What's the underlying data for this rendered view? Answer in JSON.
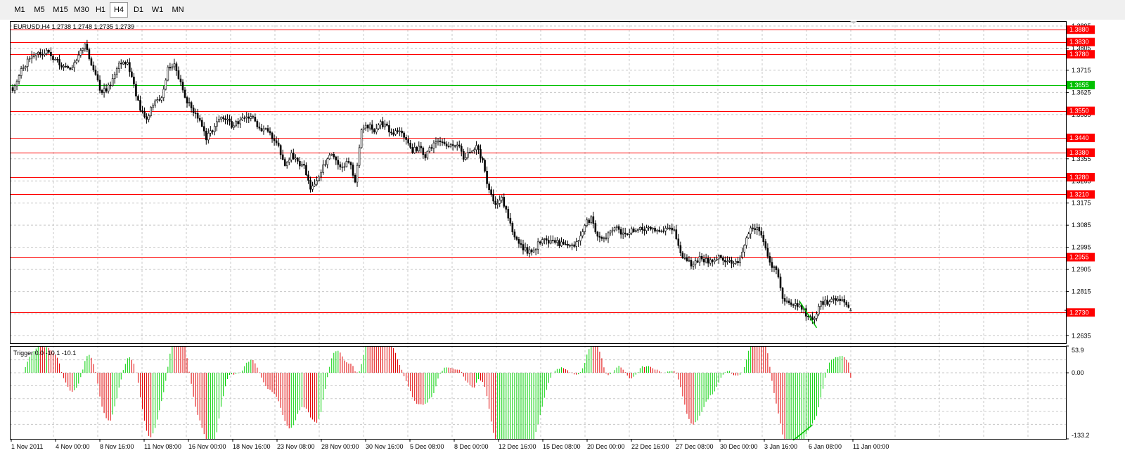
{
  "toolbar": {
    "timeframes": [
      "M1",
      "M5",
      "M15",
      "M30",
      "H1",
      "H4",
      "D1",
      "W1",
      "MN"
    ],
    "active": "H4"
  },
  "chart_data": [
    {
      "type": "candlestick",
      "title": "EURUSD,H4  1.2738 1.2748 1.2735 1.2739",
      "symbol": "EURUSD",
      "timeframe": "H4",
      "ohlc_last": {
        "open": 1.2738,
        "high": 1.2748,
        "low": 1.2735,
        "close": 1.2739
      },
      "ylim": [
        1.2605,
        1.3915
      ],
      "y_ticks": [
        "1.3895",
        "1.3805",
        "1.3715",
        "1.3625",
        "1.3535",
        "1.3355",
        "1.3265",
        "1.3175",
        "1.3085",
        "1.2995",
        "1.2905",
        "1.2815",
        "1.2725",
        "1.2635"
      ],
      "x_ticks": [
        "1 Nov 2011",
        "4 Nov 00:00",
        "8 Nov 16:00",
        "11 Nov 08:00",
        "16 Nov 00:00",
        "18 Nov 16:00",
        "23 Nov 08:00",
        "28 Nov 00:00",
        "30 Nov 16:00",
        "5 Dec 08:00",
        "8 Dec 00:00",
        "12 Dec 16:00",
        "15 Dec 08:00",
        "20 Dec 00:00",
        "22 Dec 16:00",
        "27 Dec 08:00",
        "30 Dec 00:00",
        "3 Jan 16:00",
        "6 Jan 08:00",
        "11 Jan 00:00"
      ],
      "horizontal_levels": [
        {
          "label": "1.3880",
          "color": "#ff0000"
        },
        {
          "label": "1.3830",
          "color": "#ff0000"
        },
        {
          "label": "1.3780",
          "color": "#ff0000"
        },
        {
          "label": "1.3655",
          "color": "#00c000"
        },
        {
          "label": "1.3550",
          "color": "#ff0000"
        },
        {
          "label": "1.3440",
          "color": "#ff0000"
        },
        {
          "label": "1.3380",
          "color": "#ff0000"
        },
        {
          "label": "1.3280",
          "color": "#ff0000"
        },
        {
          "label": "1.3210",
          "color": "#ff0000"
        },
        {
          "label": "1.2955",
          "color": "#ff0000"
        },
        {
          "label": "1.2730",
          "color": "#ff0000"
        }
      ],
      "current_price": "1.2739",
      "anchors": [
        [
          0,
          1.364
        ],
        [
          5,
          1.373
        ],
        [
          10,
          1.378
        ],
        [
          16,
          1.379
        ],
        [
          22,
          1.374
        ],
        [
          28,
          1.372
        ],
        [
          31,
          1.377
        ],
        [
          34,
          1.382
        ],
        [
          38,
          1.371
        ],
        [
          42,
          1.362
        ],
        [
          46,
          1.366
        ],
        [
          50,
          1.375
        ],
        [
          54,
          1.374
        ],
        [
          57,
          1.365
        ],
        [
          60,
          1.355
        ],
        [
          63,
          1.351
        ],
        [
          66,
          1.358
        ],
        [
          70,
          1.361
        ],
        [
          73,
          1.372
        ],
        [
          76,
          1.375
        ],
        [
          79,
          1.366
        ],
        [
          82,
          1.359
        ],
        [
          85,
          1.355
        ],
        [
          88,
          1.352
        ],
        [
          91,
          1.344
        ],
        [
          94,
          1.347
        ],
        [
          97,
          1.351
        ],
        [
          100,
          1.352
        ],
        [
          103,
          1.349
        ],
        [
          106,
          1.35
        ],
        [
          110,
          1.353
        ],
        [
          113,
          1.352
        ],
        [
          116,
          1.347
        ],
        [
          119,
          1.347
        ],
        [
          122,
          1.344
        ],
        [
          125,
          1.341
        ],
        [
          128,
          1.332
        ],
        [
          131,
          1.337
        ],
        [
          134,
          1.334
        ],
        [
          137,
          1.332
        ],
        [
          140,
          1.324
        ],
        [
          143,
          1.327
        ],
        [
          146,
          1.332
        ],
        [
          149,
          1.338
        ],
        [
          152,
          1.335
        ],
        [
          155,
          1.332
        ],
        [
          158,
          1.335
        ],
        [
          161,
          1.327
        ],
        [
          164,
          1.347
        ],
        [
          167,
          1.349
        ],
        [
          170,
          1.347
        ],
        [
          173,
          1.35
        ],
        [
          176,
          1.348
        ],
        [
          179,
          1.346
        ],
        [
          182,
          1.346
        ],
        [
          185,
          1.343
        ],
        [
          188,
          1.339
        ],
        [
          191,
          1.34
        ],
        [
          194,
          1.337
        ],
        [
          197,
          1.34
        ],
        [
          200,
          1.343
        ],
        [
          203,
          1.342
        ],
        [
          206,
          1.341
        ],
        [
          209,
          1.342
        ],
        [
          212,
          1.336
        ],
        [
          215,
          1.338
        ],
        [
          218,
          1.34
        ],
        [
          221,
          1.335
        ],
        [
          224,
          1.322
        ],
        [
          227,
          1.318
        ],
        [
          230,
          1.319
        ],
        [
          233,
          1.312
        ],
        [
          236,
          1.304
        ],
        [
          239,
          1.3
        ],
        [
          242,
          1.298
        ],
        [
          245,
          1.298
        ],
        [
          248,
          1.302
        ],
        [
          251,
          1.302
        ],
        [
          254,
          1.302
        ],
        [
          257,
          1.301
        ],
        [
          260,
          1.301
        ],
        [
          263,
          1.3
        ],
        [
          266,
          1.302
        ],
        [
          269,
          1.309
        ],
        [
          272,
          1.311
        ],
        [
          275,
          1.303
        ],
        [
          278,
          1.303
        ],
        [
          281,
          1.306
        ],
        [
          284,
          1.307
        ],
        [
          287,
          1.305
        ],
        [
          290,
          1.306
        ],
        [
          293,
          1.306
        ],
        [
          296,
          1.307
        ],
        [
          299,
          1.307
        ],
        [
          302,
          1.307
        ],
        [
          305,
          1.307
        ],
        [
          308,
          1.307
        ],
        [
          311,
          1.307
        ],
        [
          314,
          1.297
        ],
        [
          317,
          1.294
        ],
        [
          320,
          1.292
        ],
        [
          323,
          1.295
        ],
        [
          326,
          1.294
        ],
        [
          329,
          1.294
        ],
        [
          332,
          1.296
        ],
        [
          335,
          1.294
        ],
        [
          338,
          1.293
        ],
        [
          341,
          1.294
        ],
        [
          344,
          1.3
        ],
        [
          347,
          1.307
        ],
        [
          350,
          1.307
        ],
        [
          353,
          1.302
        ],
        [
          356,
          1.293
        ],
        [
          359,
          1.29
        ],
        [
          362,
          1.279
        ],
        [
          365,
          1.276
        ],
        [
          368,
          1.276
        ],
        [
          371,
          1.275
        ],
        [
          374,
          1.271
        ],
        [
          377,
          1.27
        ],
        [
          380,
          1.277
        ],
        [
          383,
          1.277
        ],
        [
          386,
          1.279
        ],
        [
          389,
          1.278
        ],
        [
          392,
          1.276
        ],
        [
          394,
          1.274
        ]
      ],
      "trend_line": {
        "from": [
          370,
          1.2775
        ],
        "to": [
          378,
          1.2668
        ],
        "color": "#00c000"
      }
    },
    {
      "type": "histogram",
      "title": "Trigger 0.0 -10.1 -10.1",
      "ylim": [
        -133.2,
        53.9
      ],
      "y_ticks": [
        "53.9",
        "0.00",
        "-133.2"
      ],
      "zero_label": "0.00",
      "positive_color": "#00d000",
      "negative_color": "#e00000",
      "trend_line": {
        "color": "#00c000"
      }
    }
  ]
}
